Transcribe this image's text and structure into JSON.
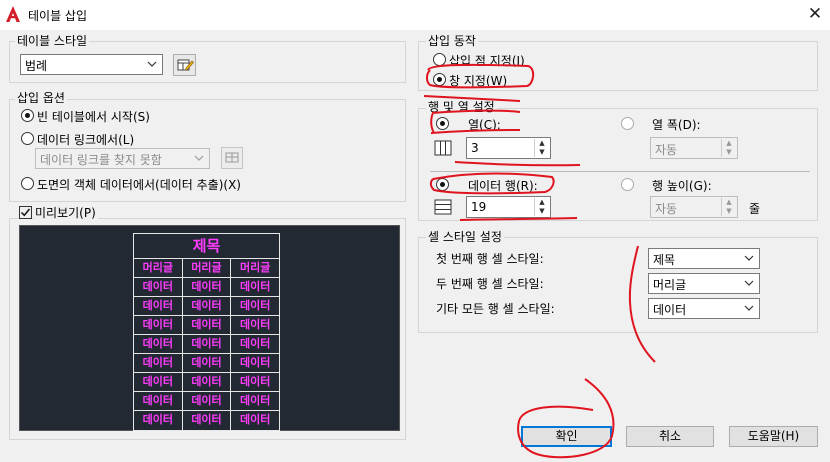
{
  "window": {
    "title": "테이블 삽입",
    "close_label": "✕"
  },
  "table_style": {
    "legend": "테이블 스타일",
    "selected": "범례"
  },
  "insert_options": {
    "legend": "삽입 옵션",
    "opt_empty": "빈 테이블에서 시작(S)",
    "opt_link": "데이터 링크에서(L)",
    "link_combo_value": "데이터 링크를 찾지 못함",
    "opt_object": "도면의 객체 데이터에서(데이터 추출)(X)"
  },
  "preview": {
    "checkbox_label": "미리보기(P)",
    "title_cell": "제목",
    "header_cells": [
      "머리글",
      "머리글",
      "머리글"
    ],
    "data_cell": "데이터",
    "data_row_count": 8
  },
  "insert_behavior": {
    "legend": "삽입 동작",
    "opt_point": "삽입 점 지정(I)",
    "opt_window": "창 지정(W)"
  },
  "rows_cols": {
    "legend": "행 및 열 설정",
    "columns_label": "열(C):",
    "columns_value": "3",
    "col_width_label": "열 폭(D):",
    "col_width_value": "자동",
    "data_rows_label": "데이터 행(R):",
    "data_rows_value": "19",
    "row_height_label": "행 높이(G):",
    "row_height_value": "자동",
    "row_height_unit": "줄"
  },
  "cell_styles": {
    "legend": "셀 스타일 설정",
    "first_row_label": "첫 번째 행 셀 스타일:",
    "first_row_value": "제목",
    "second_row_label": "두 번째 행 셀 스타일:",
    "second_row_value": "머리글",
    "other_rows_label": "기타 모든 행 셀 스타일:",
    "other_rows_value": "데이터"
  },
  "buttons": {
    "ok": "확인",
    "cancel": "취소",
    "help": "도움말(H)"
  },
  "colors": {
    "preview_bg": "#232932",
    "preview_text": "#ff3cff",
    "annotation": "#e0141e"
  }
}
